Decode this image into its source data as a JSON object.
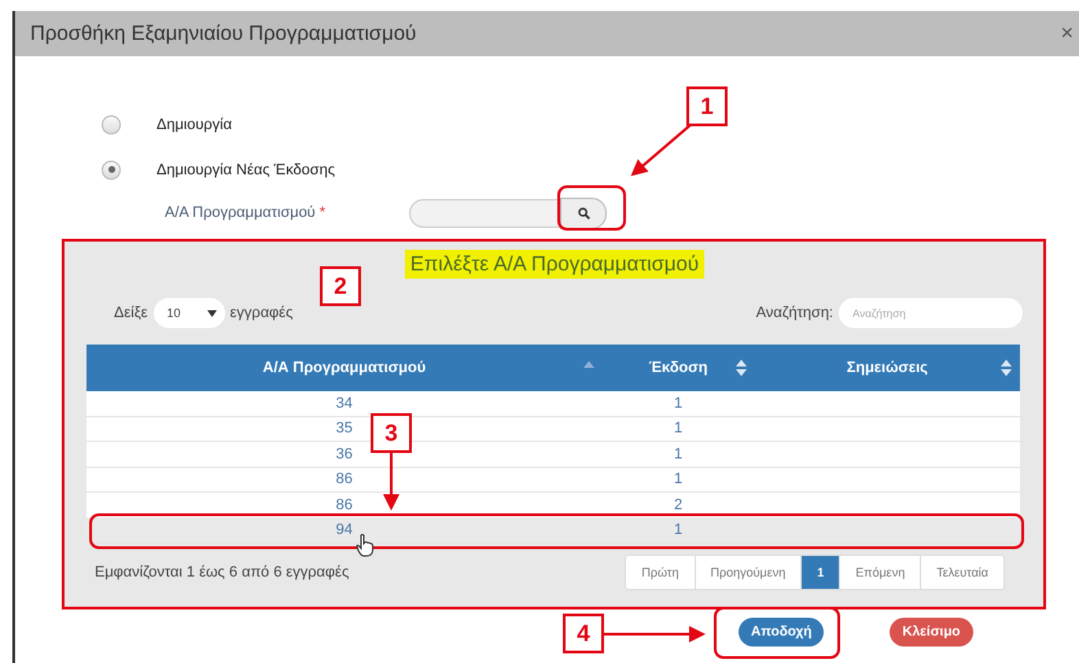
{
  "window": {
    "title": "Προσθήκη Εξαμηνιαίου Προγραμματισμού",
    "close": "×"
  },
  "options": [
    {
      "label": "Δημιουργία",
      "selected": false
    },
    {
      "label": "Δημιουργία Νέας Έκδοσης",
      "selected": true
    }
  ],
  "field": {
    "label": "Α/Α Προγραμματισμού",
    "required": "*"
  },
  "picker": {
    "title": "Επιλέξτε Α/Α Προγραμματισμού",
    "show_label": "Δείξε",
    "page_size": "10",
    "entries_label": "εγγραφές",
    "search_label": "Αναζήτηση:",
    "search_placeholder": "Αναζήτηση",
    "columns": [
      {
        "label": "Α/Α Προγραμματισμού",
        "sorted": true
      },
      {
        "label": "Έκδοση",
        "sorted": false
      },
      {
        "label": "Σημειώσεις",
        "sorted": false
      }
    ],
    "rows": [
      {
        "number": "34",
        "version": "1",
        "hovered": false
      },
      {
        "number": "35",
        "version": "1",
        "hovered": false
      },
      {
        "number": "36",
        "version": "1",
        "hovered": false
      },
      {
        "number": "86",
        "version": "1",
        "hovered": false
      },
      {
        "number": "86",
        "version": "2",
        "hovered": false
      },
      {
        "number": "94",
        "version": "1",
        "hovered": true
      }
    ],
    "info": "Εμφανίζονται 1 έως 6 από 6 εγγραφές",
    "pages": [
      {
        "label": "Πρώτη",
        "selected": false
      },
      {
        "label": "Προηγούμενη",
        "selected": false
      },
      {
        "label": "1",
        "selected": true
      },
      {
        "label": "Επόμενη",
        "selected": false
      },
      {
        "label": "Τελευταία",
        "selected": false
      }
    ]
  },
  "buttons": [
    {
      "label": "Αποδοχή",
      "kind": "primary"
    },
    {
      "label": "Κλείσιμο",
      "kind": "danger"
    }
  ],
  "callouts": [
    "1",
    "2",
    "3",
    "4"
  ]
}
